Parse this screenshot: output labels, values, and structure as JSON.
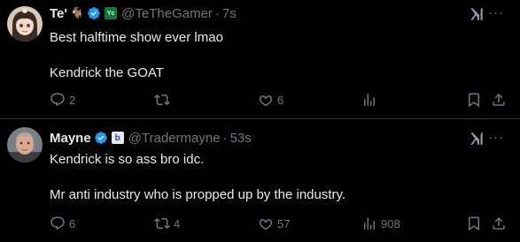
{
  "tweets": [
    {
      "name": "Te'",
      "emoji": "🐐",
      "affiliate_badge": "Yc",
      "handle": "@TeTheGamer",
      "time": "7s",
      "text": "Best halftime show ever lmao\n\nKendrick the GOAT",
      "replies": "2",
      "retweets": "",
      "likes": "6",
      "views": ""
    },
    {
      "name": "Mayne",
      "emoji": "",
      "affiliate_badge": "b",
      "handle": "@Tradermayne",
      "time": "53s",
      "text": "Kendrick is so ass bro idc.\n\nMr anti industry who is propped up by the industry.",
      "replies": "6",
      "retweets": "4",
      "likes": "57",
      "views": "908"
    }
  ],
  "separator": "·",
  "more_label": "···",
  "colors": {
    "background": "#000000",
    "text": "#e7e9ea",
    "muted": "#71767b",
    "verified": "#1d9bf0",
    "divider": "#2f3336"
  }
}
